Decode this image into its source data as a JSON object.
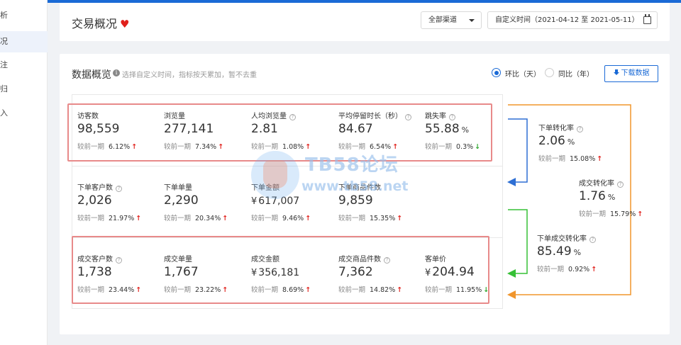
{
  "sidebar": {
    "items": [
      {
        "label": "析",
        "active": false
      },
      {
        "label": "况",
        "active": true
      },
      {
        "label": "注",
        "active": false
      },
      {
        "label": "归",
        "active": false
      },
      {
        "label": "入",
        "active": false
      }
    ]
  },
  "header": {
    "title": "交易概况",
    "channel_select": "全部渠道",
    "date_range": "自定义时间（2021-04-12 至 2021-05-11）"
  },
  "overview": {
    "title": "数据概览",
    "hint": "选择自定义时间，指标按天累加，暂不去重",
    "radio_mom": "环比（天）",
    "radio_yoy": "同比（年）",
    "download_label": "下载数据",
    "compare_label": "较前一期",
    "rows": [
      [
        {
          "label": "访客数",
          "value": "98,559",
          "prefix": "",
          "unit": "",
          "change": "6.12%",
          "trend": "up",
          "help": false
        },
        {
          "label": "浏览量",
          "value": "277,141",
          "prefix": "",
          "unit": "",
          "change": "7.34%",
          "trend": "up",
          "help": false
        },
        {
          "label": "人均浏览量",
          "value": "2.81",
          "prefix": "",
          "unit": "",
          "change": "1.08%",
          "trend": "up",
          "help": true
        },
        {
          "label": "平均停留时长（秒）",
          "value": "84.67",
          "prefix": "",
          "unit": "",
          "change": "6.54%",
          "trend": "up",
          "help": true
        },
        {
          "label": "跳失率",
          "value": "55.88",
          "prefix": "",
          "unit": "%",
          "change": "0.3%",
          "trend": "down",
          "help": true
        }
      ],
      [
        {
          "label": "下单客户数",
          "value": "2,026",
          "prefix": "",
          "unit": "",
          "change": "21.97%",
          "trend": "up",
          "help": true
        },
        {
          "label": "下单单量",
          "value": "2,290",
          "prefix": "",
          "unit": "",
          "change": "20.34%",
          "trend": "up",
          "help": false
        },
        {
          "label": "下单金额",
          "value": "617,007",
          "prefix": "¥",
          "unit": "",
          "change": "9.46%",
          "trend": "up",
          "help": false
        },
        {
          "label": "下单商品件数",
          "value": "9,859",
          "prefix": "",
          "unit": "",
          "change": "15.35%",
          "trend": "up",
          "help": false
        }
      ],
      [
        {
          "label": "成交客户数",
          "value": "1,738",
          "prefix": "",
          "unit": "",
          "change": "23.44%",
          "trend": "up",
          "help": true
        },
        {
          "label": "成交单量",
          "value": "1,767",
          "prefix": "",
          "unit": "",
          "change": "23.22%",
          "trend": "up",
          "help": false
        },
        {
          "label": "成交金额",
          "value": "356,181",
          "prefix": "¥",
          "unit": "",
          "change": "8.69%",
          "trend": "up",
          "help": false
        },
        {
          "label": "成交商品件数",
          "value": "7,362",
          "prefix": "",
          "unit": "",
          "change": "14.82%",
          "trend": "up",
          "help": true
        },
        {
          "label": "客单价",
          "value": "204.94",
          "prefix": "¥",
          "unit": "",
          "change": "11.95%",
          "trend": "down",
          "help": false
        }
      ]
    ],
    "conversions": [
      {
        "label": "下单转化率",
        "value": "2.06",
        "unit": "%",
        "change": "15.08%",
        "trend": "up"
      },
      {
        "label": "成交转化率",
        "value": "1.76",
        "unit": "%",
        "change": "15.79%",
        "trend": "up"
      },
      {
        "label": "下单成交转化率",
        "value": "85.49",
        "unit": "%",
        "change": "0.92%",
        "trend": "up"
      }
    ]
  },
  "watermark": {
    "title": "TB58论坛",
    "url": "www.tb58.net"
  },
  "colors": {
    "accent": "#1a6ad6",
    "up": "#e0201b",
    "down": "#2aa52a",
    "highlight_box": "#e88a8a",
    "flow_orange": "#f0952c",
    "flow_blue": "#2e6fd4",
    "flow_green": "#36c036"
  },
  "icons": {
    "heart": "heart-icon",
    "info": "info-icon",
    "help": "question-circle-icon",
    "calendar": "calendar-icon",
    "download": "download-icon",
    "caret": "caret-down-icon"
  }
}
